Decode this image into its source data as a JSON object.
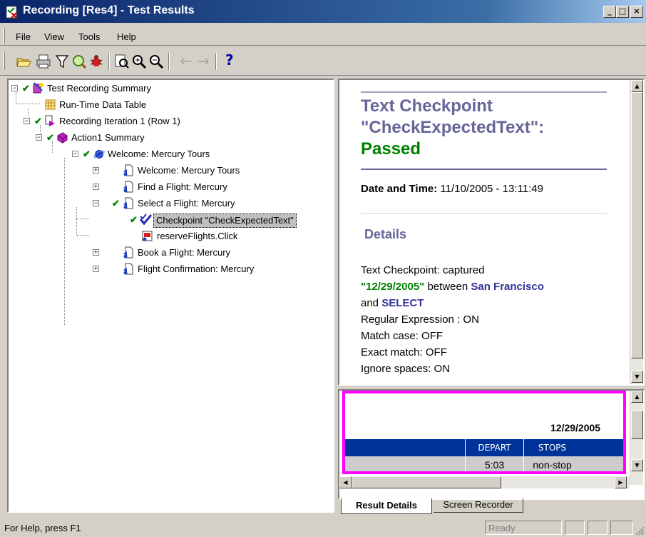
{
  "window": {
    "title": "Recording [Res4] - Test Results",
    "controls": {
      "minimize": "_",
      "maximize": "□",
      "close": "×"
    }
  },
  "menu": [
    "File",
    "View",
    "Tools",
    "Help"
  ],
  "toolbar": {
    "buttons": [
      "open-icon",
      "print-icon",
      "filter-icon",
      "find-icon",
      "bug-icon",
      "preview-icon",
      "zoom-in-icon",
      "zoom-out-icon",
      "back-arrow-icon",
      "forward-arrow-icon",
      "help-icon"
    ],
    "help_label": "?"
  },
  "tree": {
    "nodes": [
      {
        "label": "Test Recording Summary",
        "icon": "test-summary-icon",
        "status": "passed"
      },
      {
        "label": "Run-Time Data Table",
        "icon": "data-table-icon"
      },
      {
        "label": "Recording Iteration 1 (Row 1)",
        "icon": "iteration-icon",
        "status": "passed"
      },
      {
        "label": "Action1 Summary",
        "icon": "action-icon",
        "status": "passed"
      },
      {
        "label": "Welcome: Mercury Tours",
        "icon": "browser-icon",
        "status": "passed"
      },
      {
        "label": "Welcome: Mercury Tours",
        "icon": "page-icon"
      },
      {
        "label": "Find a Flight: Mercury",
        "icon": "page-icon"
      },
      {
        "label": "Select a Flight: Mercury",
        "icon": "page-icon",
        "status": "passed"
      },
      {
        "label": "Checkpoint \"CheckExpectedText\"",
        "icon": "checkpoint-icon",
        "status": "passed",
        "selected": true
      },
      {
        "label": "reserveFlights.Click",
        "icon": "button-step-icon"
      },
      {
        "label": "Book a Flight: Mercury",
        "icon": "page-icon"
      },
      {
        "label": "Flight Confirmation: Mercury",
        "icon": "page-icon"
      }
    ]
  },
  "result": {
    "heading_line1": "Text Checkpoint",
    "heading_line2": "\"CheckExpectedText\":",
    "heading_status": "Passed",
    "datetime_label": "Date and Time:",
    "datetime_value": "11/10/2005 - 13:11:49",
    "details_heading": "Details",
    "captured_prefix": "Text Checkpoint: captured",
    "captured_value": "\"12/29/2005\"",
    "between_word": "between",
    "from_value": "San Francisco",
    "and_word": "and",
    "to_value": "SELECT",
    "options": [
      "Regular Expression : ON",
      "Match case: OFF",
      "Exact match: OFF",
      "Ignore spaces: ON"
    ]
  },
  "screenshot_panel": {
    "date": "12/29/2005",
    "columns": [
      "DEPART",
      "STOPS"
    ],
    "row": [
      "5:03",
      "non-stop"
    ],
    "highlight_color": "#ff00ff"
  },
  "tabs": [
    "Result Details",
    "Screen Recorder"
  ],
  "status": {
    "help_text": "For Help, press F1",
    "state": "Ready"
  },
  "colors": {
    "heading": "#666699",
    "passed": "#008000",
    "link_value": "#333399",
    "table_header": "#003399"
  }
}
